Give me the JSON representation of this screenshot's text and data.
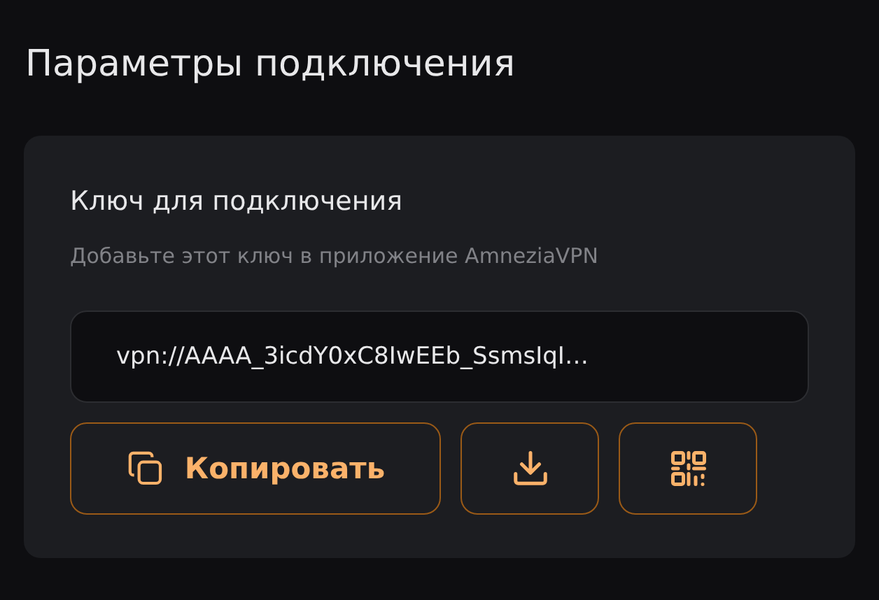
{
  "title": "Параметры подключения",
  "card": {
    "heading": "Ключ для подключения",
    "hint": "Добавьте этот ключ в приложение AmneziaVPN",
    "key_field": {
      "value": "vpn://AAAA_3icdY0xC8IwEEb_SsmsIqI…"
    },
    "buttons": [
      {
        "kind": "copy",
        "label": "Копировать"
      },
      {
        "kind": "download"
      },
      {
        "kind": "qr"
      }
    ]
  }
}
